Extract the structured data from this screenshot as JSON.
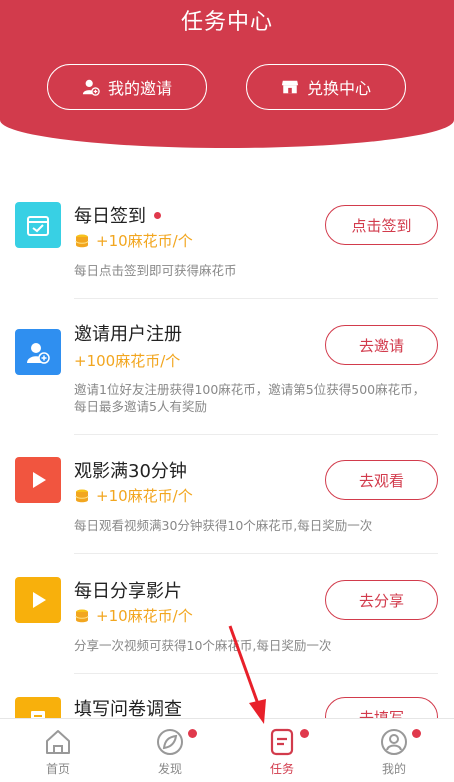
{
  "header": {
    "title": "任务中心",
    "invite_label": "我的邀请",
    "exchange_label": "兑换中心"
  },
  "tasks": [
    {
      "title": "每日签到",
      "has_dot": true,
      "reward": "+10麻花币/个",
      "desc": "每日点击签到即可获得麻花币",
      "button": "点击签到",
      "icon": "calendar-check-icon",
      "color": "#38d0e4"
    },
    {
      "title": "邀请用户注册",
      "has_dot": false,
      "reward": "+100麻花币/个",
      "desc": "邀请1位好友注册获得100麻花币，邀请第5位获得500麻花币，每日最多邀请5人有奖励",
      "button": "去邀请",
      "icon": "user-add-icon",
      "color": "#2f8ff0"
    },
    {
      "title": "观影满30分钟",
      "has_dot": false,
      "reward": "+10麻花币/个",
      "desc": "每日观看视频满30分钟获得10个麻花币,每日奖励一次",
      "button": "去观看",
      "icon": "play-icon",
      "color": "#f1553f"
    },
    {
      "title": "每日分享影片",
      "has_dot": false,
      "reward": "+10麻花币/个",
      "desc": "分享一次视频可获得10个麻花币,每日奖励一次",
      "button": "去分享",
      "icon": "play-icon",
      "color": "#f8b00c"
    },
    {
      "title": "填写问卷调查",
      "has_dot": false,
      "reward": "",
      "desc": "",
      "button": "去填写",
      "icon": "document-icon",
      "color": "#f8b00c"
    }
  ],
  "tabbar": {
    "items": [
      {
        "label": "首页",
        "icon": "home-icon",
        "active": false,
        "dot": false
      },
      {
        "label": "发现",
        "icon": "compass-icon",
        "active": false,
        "dot": true
      },
      {
        "label": "任务",
        "icon": "task-icon",
        "active": true,
        "dot": true
      },
      {
        "label": "我的",
        "icon": "profile-icon",
        "active": false,
        "dot": true
      }
    ]
  },
  "colors": {
    "brand": "#d23b4c",
    "reward": "#f2a61f",
    "annotation": "#e8202a"
  }
}
